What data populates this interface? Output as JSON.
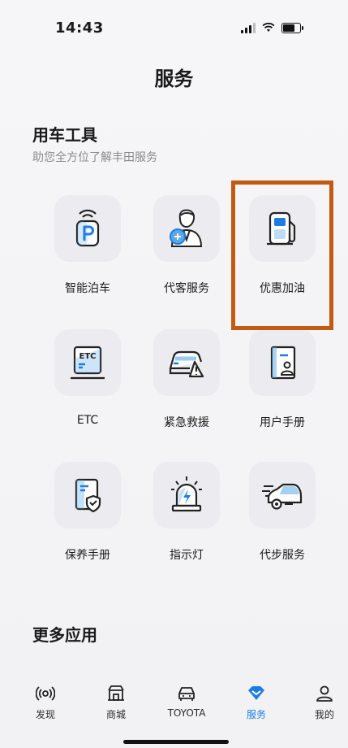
{
  "status_bar": {
    "time": "14:43"
  },
  "page": {
    "title": "服务"
  },
  "tools_section": {
    "title": "用车工具",
    "subtitle": "助您全方位了解丰田服务",
    "items": [
      {
        "label": "智能泊车",
        "icon": "smart-parking-icon"
      },
      {
        "label": "代客服务",
        "icon": "valet-service-icon"
      },
      {
        "label": "优惠加油",
        "icon": "fuel-discount-icon"
      },
      {
        "label": "ETC",
        "icon": "etc-icon"
      },
      {
        "label": "紧急救援",
        "icon": "emergency-rescue-icon"
      },
      {
        "label": "用户手册",
        "icon": "user-manual-icon"
      },
      {
        "label": "保养手册",
        "icon": "maintenance-manual-icon"
      },
      {
        "label": "指示灯",
        "icon": "indicator-light-icon"
      },
      {
        "label": "代步服务",
        "icon": "mobility-service-icon"
      }
    ]
  },
  "more_section": {
    "title": "更多应用"
  },
  "tabbar": {
    "tabs": [
      {
        "label": "发现",
        "icon": "discover-icon"
      },
      {
        "label": "商城",
        "icon": "mall-icon"
      },
      {
        "label": "TOYOTA",
        "icon": "car-icon"
      },
      {
        "label": "服务",
        "icon": "service-icon",
        "active": true
      },
      {
        "label": "我的",
        "icon": "profile-icon"
      }
    ]
  },
  "colors": {
    "accent": "#1f7de2",
    "highlight_box": "#c35a12",
    "icon_blue": "#5aa9e6"
  }
}
